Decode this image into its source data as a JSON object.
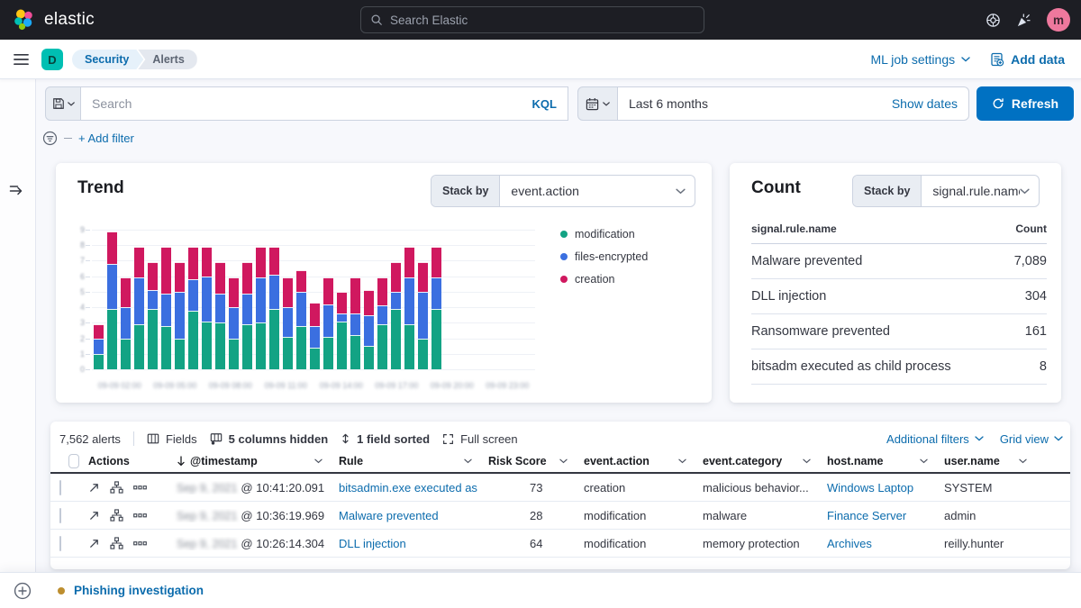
{
  "topbar": {
    "brand": "elastic",
    "search_placeholder": "Search Elastic",
    "avatar_initial": "m"
  },
  "navbar": {
    "space_initial": "D",
    "breadcrumbs": [
      "Security",
      "Alerts"
    ],
    "ml_job_settings": "ML job settings",
    "add_data": "Add data"
  },
  "querybar": {
    "search_placeholder": "Search",
    "kql_label": "KQL",
    "date_range": "Last 6 months",
    "show_dates": "Show dates",
    "refresh_label": "Refresh",
    "add_filter": "+ Add filter"
  },
  "trend": {
    "title": "Trend",
    "stack_by_label": "Stack by",
    "stack_by_value": "event.action"
  },
  "chart_data": {
    "type": "bar",
    "stacked": true,
    "title": "Trend",
    "stack_by_field": "event.action",
    "ylim": [
      0,
      9
    ],
    "y_ticks": [
      0,
      1,
      2,
      3,
      4,
      5,
      6,
      7,
      8,
      9
    ],
    "x_tick_labels": [
      "09-09 02:00",
      "09-09 05:00",
      "09-09 08:00",
      "09-09 11:00",
      "09-09 14:00",
      "09-09 17:00",
      "09-09 20:00",
      "09-09 23:00"
    ],
    "x_tick_labels_redacted": true,
    "legend_position": "right",
    "series": [
      {
        "name": "modification",
        "color": "#13a384",
        "values": [
          1,
          3.9,
          2,
          2.9,
          3.9,
          2.8,
          2,
          3.8,
          3.1,
          3,
          2,
          2.9,
          3,
          3.9,
          2.1,
          2.8,
          1.4,
          2.1,
          3.1,
          2.2,
          1.5,
          2.9,
          3.9,
          2.9,
          2,
          3.9
        ]
      },
      {
        "name": "files-encrypted",
        "color": "#3b6fe0",
        "values": [
          1,
          2.9,
          2,
          3,
          1.2,
          2.1,
          3,
          2,
          2.9,
          1.9,
          2,
          2,
          2.9,
          2.2,
          1.9,
          2.2,
          1.4,
          2.1,
          0.5,
          1.4,
          2,
          1.2,
          1.1,
          3,
          3,
          2
        ]
      },
      {
        "name": "creation",
        "color": "#d0185f",
        "values": [
          0.9,
          2.1,
          1.9,
          2,
          1.8,
          3,
          1.9,
          2.1,
          1.9,
          2,
          1.9,
          2,
          2,
          1.8,
          1.9,
          1.4,
          1.5,
          1.7,
          1.4,
          2.3,
          1.6,
          1.8,
          1.9,
          2,
          1.9,
          2
        ]
      }
    ]
  },
  "count": {
    "title": "Count",
    "stack_by_label": "Stack by",
    "stack_by_value": "signal.rule.name",
    "headers": [
      "signal.rule.name",
      "Count"
    ],
    "rows": [
      [
        "Malware prevented",
        "7,089"
      ],
      [
        "DLL injection",
        "304"
      ],
      [
        "Ransomware prevented",
        "161"
      ],
      [
        "bitsadm executed as child process",
        "8"
      ]
    ]
  },
  "alerts": {
    "count_label": "7,562 alerts",
    "fields_label": "Fields",
    "columns_hidden_label": "5 columns hidden",
    "field_sorted_label": "1 field sorted",
    "full_screen_label": "Full screen",
    "additional_filters_label": "Additional filters",
    "grid_view_label": "Grid view",
    "columns": [
      "Actions",
      "@timestamp",
      "Rule",
      "Risk Score",
      "event.action",
      "event.category",
      "host.name",
      "user.name"
    ],
    "rows": [
      {
        "date": "Sep 9, 2021",
        "time": "@ 10:41:20.091",
        "rule": "bitsadmin.exe executed as ...",
        "risk_score": "73",
        "event_action": "creation",
        "event_category": "malicious behavior...",
        "host_name": "Windows Laptop",
        "user_name": "SYSTEM"
      },
      {
        "date": "Sep 9, 2021",
        "time": "@ 10:36:19.969",
        "rule": "Malware prevented",
        "risk_score": "28",
        "event_action": "modification",
        "event_category": "malware",
        "host_name": "Finance Server",
        "user_name": "admin"
      },
      {
        "date": "Sep 9, 2021",
        "time": "@ 10:26:14.304",
        "rule": "DLL injection",
        "risk_score": "64",
        "event_action": "modification",
        "event_category": "memory protection",
        "host_name": "Archives",
        "user_name": "reilly.hunter"
      }
    ]
  },
  "timeline": {
    "title": "Phishing investigation"
  },
  "colors": {
    "header_bg": "#1d1e24",
    "primary_button": "#0071c2",
    "link": "#0c6cad",
    "chart_green": "#13a384",
    "chart_blue": "#3b6fe0",
    "chart_pink": "#d0185f",
    "space_badge": "#00bfb3",
    "avatar_bg": "#ee789d",
    "timeline_dot": "#bd8e2f"
  }
}
